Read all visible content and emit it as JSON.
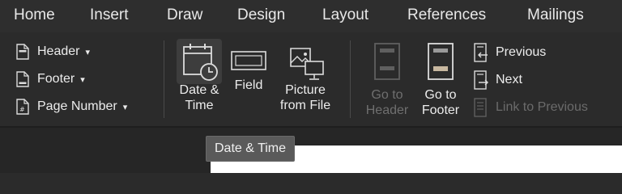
{
  "tabs": [
    "Home",
    "Insert",
    "Draw",
    "Design",
    "Layout",
    "References",
    "Mailings"
  ],
  "header_footer": {
    "header_label": "Header",
    "footer_label": "Footer",
    "page_number_label": "Page Number",
    "chevron": "▾"
  },
  "insert": {
    "date_time_line1": "Date &",
    "date_time_line2": "Time",
    "field_label": "Field",
    "picture_line1": "Picture",
    "picture_line2": "from File"
  },
  "navigation": {
    "go_header_line1": "Go to",
    "go_header_line2": "Header",
    "go_footer_line1": "Go to",
    "go_footer_line2": "Footer",
    "previous_label": "Previous",
    "next_label": "Next",
    "link_previous_label": "Link to Previous"
  },
  "tooltip": {
    "text": "Date & Time"
  },
  "icons": {
    "header": "page-header-icon",
    "footer": "page-footer-icon",
    "page_number": "page-number-icon",
    "date_time": "calendar-clock-icon",
    "field": "field-icon",
    "picture": "picture-from-file-icon",
    "go_to_header": "go-to-header-icon",
    "go_to_footer": "go-to-footer-icon",
    "previous": "previous-section-icon",
    "next": "next-section-icon",
    "link_previous": "link-to-previous-icon"
  }
}
